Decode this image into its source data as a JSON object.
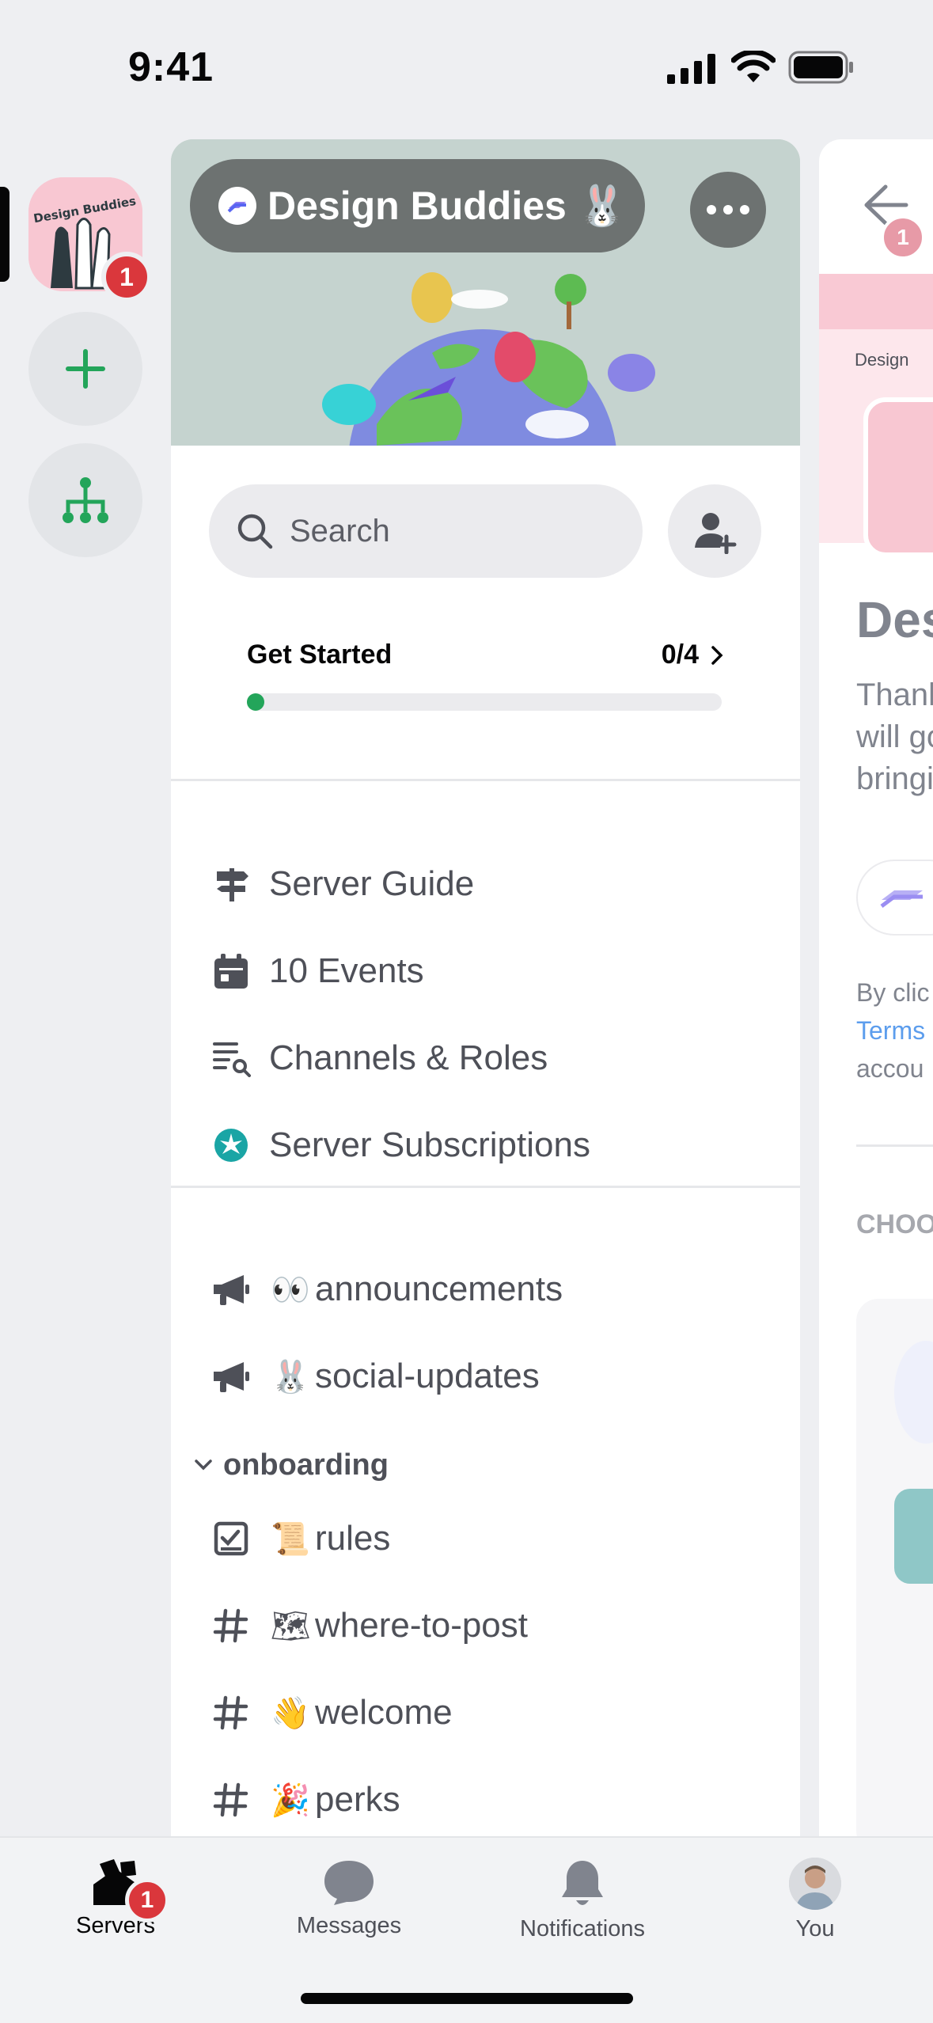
{
  "status_bar": {
    "time": "9:41"
  },
  "rail": {
    "server_badge": "1",
    "server_art_text": "Design Buddies",
    "add_server_icon": "plus-icon",
    "discover_icon": "hub-icon"
  },
  "server": {
    "name": "Design Buddies 🐰",
    "boost_icon": "boost-icon"
  },
  "search": {
    "placeholder": "Search"
  },
  "get_started": {
    "label": "Get Started",
    "count": "0/4",
    "progress": 0.02
  },
  "quick_links": [
    {
      "icon": "signpost-icon",
      "label": "Server Guide"
    },
    {
      "icon": "calendar-icon",
      "label": "10 Events"
    },
    {
      "icon": "channels-list-icon",
      "label": "Channels & Roles"
    },
    {
      "icon": "subscriptions-icon",
      "label": "Server Subscriptions"
    }
  ],
  "channels": [
    {
      "icon": "megaphone-icon",
      "emoji": "👀",
      "label": "announcements"
    },
    {
      "icon": "megaphone-icon",
      "emoji": "🐰",
      "label": "social-updates"
    }
  ],
  "category": {
    "label": "onboarding",
    "channels": [
      {
        "icon": "rules-icon",
        "emoji": "📜",
        "label": "rules"
      },
      {
        "icon": "hash-icon",
        "emoji": "🗺",
        "label": "where-to-post"
      },
      {
        "icon": "hash-icon",
        "emoji": "👋",
        "label": "welcome"
      },
      {
        "icon": "hash-icon",
        "emoji": "🎉",
        "label": "perks"
      }
    ]
  },
  "peek": {
    "badge": "1",
    "logo_text": "Design",
    "title": "Des",
    "desc1": "Thank",
    "desc2": "will go",
    "desc3": "bringi",
    "by": "By clic",
    "terms": "Terms",
    "account": "accou",
    "choose": "CHOO"
  },
  "bottom_nav": [
    {
      "label": "Servers",
      "badge": "1"
    },
    {
      "label": "Messages"
    },
    {
      "label": "Notifications"
    },
    {
      "label": "You"
    }
  ],
  "colors": {
    "accent_green": "#23a55a",
    "badge_red": "#da373c",
    "link_blue": "#5c9ded"
  }
}
